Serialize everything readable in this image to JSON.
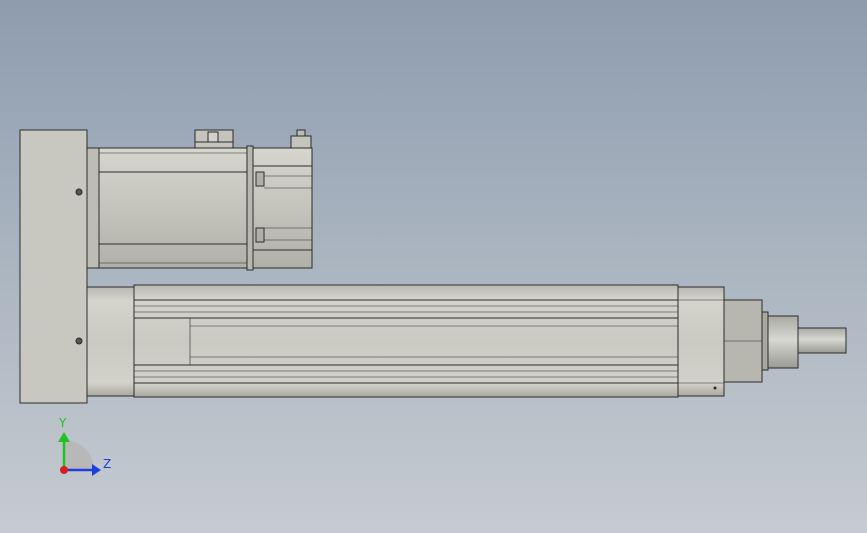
{
  "viewport": {
    "background_top": "#8e9cae",
    "background_bottom": "#c6cbd1"
  },
  "model": {
    "part_fill": "#c9c9c1",
    "part_shade": "#a9a9a1",
    "edge_color": "#2b2b2b"
  },
  "triad": {
    "y_label": "Y",
    "z_label": "Z",
    "y_color": "#1fc21f",
    "z_color": "#1f3fd8",
    "x_color": "#d81f1f"
  }
}
